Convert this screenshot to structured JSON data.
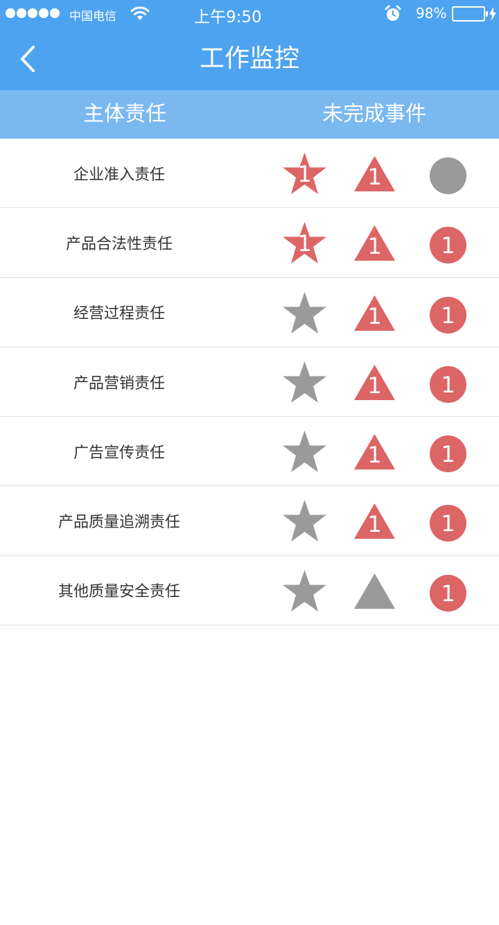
{
  "status_bar": {
    "carrier": "中国电信",
    "time": "上午9:50",
    "battery": "98%",
    "battery_level": 0.98,
    "signal_bars": 5
  },
  "nav": {
    "title": "工作监控",
    "back_icon": "chevron-left-icon"
  },
  "tabs": [
    {
      "label": "主体责任",
      "selected": true
    },
    {
      "label": "未完成事件",
      "selected": false
    }
  ],
  "colors": {
    "brand_blue": "#4da3f0",
    "tab_blue": "#7ab8f0",
    "alert_red": "#dc6566",
    "neutral_gray": "#9a9a9a"
  },
  "rows": [
    {
      "label": "企业准入责任",
      "star": {
        "active": true,
        "count": "1"
      },
      "triangle": {
        "active": true,
        "count": "1"
      },
      "circle": {
        "active": false,
        "count": ""
      }
    },
    {
      "label": "产品合法性责任",
      "star": {
        "active": true,
        "count": "1"
      },
      "triangle": {
        "active": true,
        "count": "1"
      },
      "circle": {
        "active": true,
        "count": "1"
      }
    },
    {
      "label": "经营过程责任",
      "star": {
        "active": false,
        "count": ""
      },
      "triangle": {
        "active": true,
        "count": "1"
      },
      "circle": {
        "active": true,
        "count": "1"
      }
    },
    {
      "label": "产品营销责任",
      "star": {
        "active": false,
        "count": ""
      },
      "triangle": {
        "active": true,
        "count": "1"
      },
      "circle": {
        "active": true,
        "count": "1"
      }
    },
    {
      "label": "广告宣传责任",
      "star": {
        "active": false,
        "count": ""
      },
      "triangle": {
        "active": true,
        "count": "1"
      },
      "circle": {
        "active": true,
        "count": "1"
      }
    },
    {
      "label": "产品质量追溯责任",
      "star": {
        "active": false,
        "count": ""
      },
      "triangle": {
        "active": true,
        "count": "1"
      },
      "circle": {
        "active": true,
        "count": "1"
      }
    },
    {
      "label": "其他质量安全责任",
      "star": {
        "active": false,
        "count": ""
      },
      "triangle": {
        "active": false,
        "count": ""
      },
      "circle": {
        "active": true,
        "count": "1"
      }
    }
  ]
}
